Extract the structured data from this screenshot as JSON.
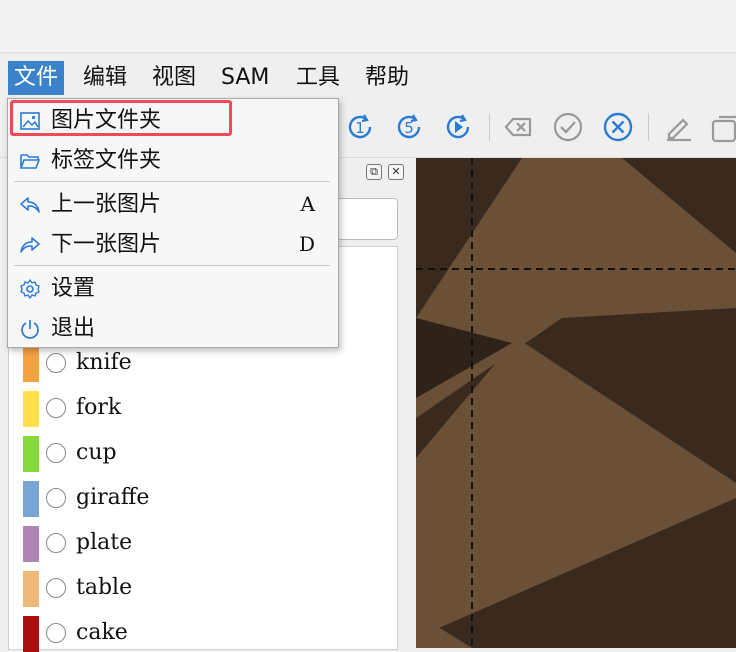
{
  "menubar": {
    "items": [
      {
        "label": "文件",
        "active": true
      },
      {
        "label": "编辑"
      },
      {
        "label": "视图"
      },
      {
        "label": "SAM"
      },
      {
        "label": "工具"
      },
      {
        "label": "帮助"
      }
    ]
  },
  "file_menu": {
    "items": [
      {
        "label": "图片文件夹",
        "icon": "image-icon",
        "shortcut": "",
        "highlighted": true
      },
      {
        "label": "标签文件夹",
        "icon": "folder-open-icon",
        "shortcut": ""
      },
      {
        "label": "上一张图片",
        "icon": "arrow-back-icon",
        "shortcut": "A"
      },
      {
        "label": "下一张图片",
        "icon": "arrow-forward-icon",
        "shortcut": "D"
      },
      {
        "label": "设置",
        "icon": "gear-icon",
        "shortcut": ""
      },
      {
        "label": "退出",
        "icon": "power-icon",
        "shortcut": ""
      }
    ]
  },
  "toolbar": {
    "icons": [
      "jump-1-icon",
      "jump-5-icon",
      "play-next-icon",
      "delete-backspace-icon",
      "check-circle-icon",
      "cancel-circle-icon",
      "edit-pencil-icon",
      "copy-icon"
    ]
  },
  "labels_panel": {
    "items": [
      {
        "name": "knife",
        "color": "#f4a142"
      },
      {
        "name": "fork",
        "color": "#ffe14d"
      },
      {
        "name": "cup",
        "color": "#86d93a"
      },
      {
        "name": "giraffe",
        "color": "#7aa6d6"
      },
      {
        "name": "plate",
        "color": "#b084b5"
      },
      {
        "name": "table",
        "color": "#eeb877"
      },
      {
        "name": "cake",
        "color": "#a90f0f"
      }
    ]
  },
  "colors": {
    "accent": "#3b83c9",
    "highlight_border": "#ef4b57",
    "canvas_dark": "#3a2a1d",
    "canvas_light": "#6a5037"
  }
}
